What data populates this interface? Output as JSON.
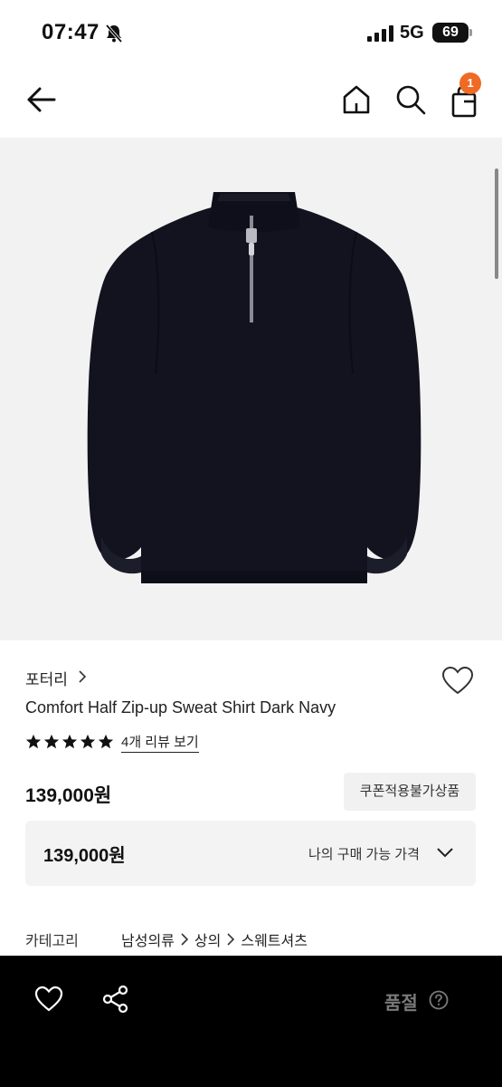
{
  "status_bar": {
    "time": "07:47",
    "network": "5G",
    "battery": "69"
  },
  "nav": {
    "cart_count": "1"
  },
  "product": {
    "brand": "포터리",
    "name": "Comfort Half Zip-up Sweat Shirt Dark Navy",
    "rating_stars": 5,
    "review_link": "4개 리뷰 보기",
    "price": "139,000원",
    "coupon_note": "쿠폰적용불가상품",
    "my_price_amount": "139,000원",
    "my_price_label": "나의 구매 가능 가격"
  },
  "category": {
    "label": "카테고리",
    "path": [
      "남성의류",
      "상의",
      "스웨트셔츠"
    ]
  },
  "bottom_bar": {
    "status": "품절"
  },
  "colors": {
    "badge": "#ef6a25",
    "garment": "#12131f",
    "bottom_bar": "#000000"
  }
}
